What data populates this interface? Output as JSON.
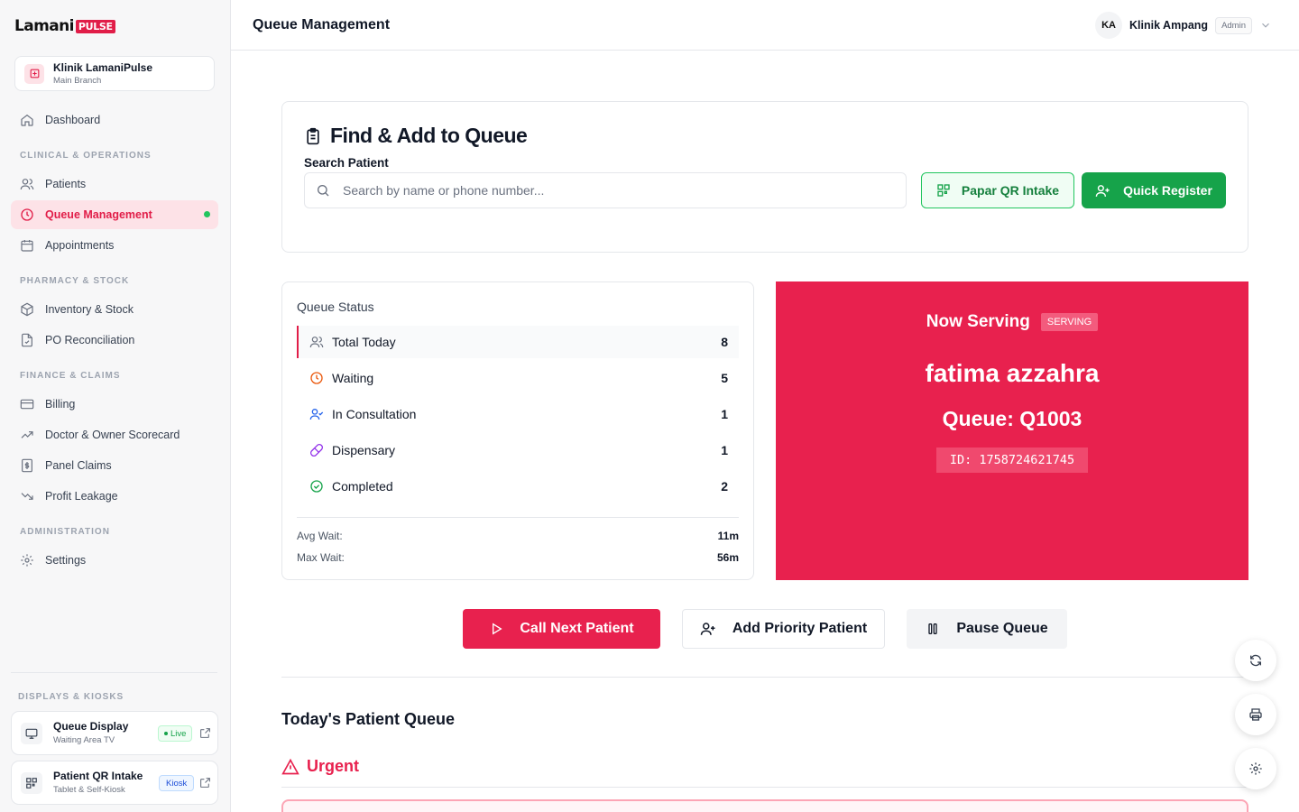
{
  "brand": {
    "logo_text": "Lamani",
    "logo_badge": "PULSE"
  },
  "clinic": {
    "name": "Klinik LamaniPulse",
    "branch": "Main Branch"
  },
  "nav": {
    "dashboard": "Dashboard",
    "sections": {
      "clinical": "CLINICAL & OPERATIONS",
      "pharmacy": "PHARMACY & STOCK",
      "finance": "FINANCE & CLAIMS",
      "admin": "ADMINISTRATION",
      "displays": "DISPLAYS & KIOSKS"
    },
    "items": {
      "patients": "Patients",
      "queue": "Queue Management",
      "appointments": "Appointments",
      "inventory": "Inventory & Stock",
      "po": "PO Reconciliation",
      "billing": "Billing",
      "scorecard": "Doctor & Owner Scorecard",
      "panel": "Panel Claims",
      "leakage": "Profit Leakage",
      "settings": "Settings"
    },
    "active": "queue"
  },
  "kiosks": [
    {
      "title": "Queue Display",
      "subtitle": "Waiting Area TV",
      "badge": "Live"
    },
    {
      "title": "Patient QR Intake",
      "subtitle": "Tablet & Self-Kiosk",
      "badge": "Kiosk"
    }
  ],
  "header": {
    "title": "Queue Management",
    "user_initials": "KA",
    "user_name": "Klinik Ampang",
    "role": "Admin"
  },
  "find": {
    "title": "Find & Add to Queue",
    "search_label": "Search Patient",
    "search_placeholder": "Search by name or phone number...",
    "qr_button": "Papar QR Intake",
    "register_button": "Quick Register"
  },
  "status": {
    "title": "Queue Status",
    "rows": [
      {
        "label": "Total Today",
        "count": "8"
      },
      {
        "label": "Waiting",
        "count": "5"
      },
      {
        "label": "In Consultation",
        "count": "1"
      },
      {
        "label": "Dispensary",
        "count": "1"
      },
      {
        "label": "Completed",
        "count": "2"
      }
    ],
    "avg_wait_label": "Avg Wait:",
    "avg_wait": "11m",
    "max_wait_label": "Max Wait:",
    "max_wait": "56m"
  },
  "serving": {
    "title": "Now Serving",
    "badge": "SERVING",
    "patient_name": "fatima azzahra",
    "queue_label": "Queue: Q1003",
    "id_label": "ID: 1758724621745"
  },
  "actions": {
    "call_next": "Call Next Patient",
    "add_priority": "Add Priority Patient",
    "pause": "Pause Queue"
  },
  "queue_list": {
    "title": "Today's Patient Queue",
    "urgent_label": "Urgent"
  },
  "colors": {
    "accent": "#e8214e",
    "success": "#16a34a",
    "sidebar_bg": "#f7f7f8"
  }
}
